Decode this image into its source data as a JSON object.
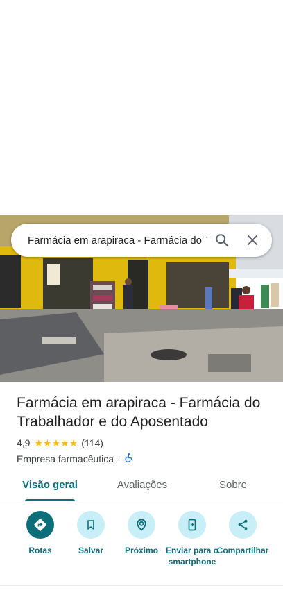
{
  "search": {
    "query": "Farmácia em arapiraca - Farmácia do Trabalhador e do Aposentado"
  },
  "place": {
    "name": "Farmácia em arapiraca - Farmácia do Trabalhador e do Aposentado",
    "rating": "4,9",
    "stars": 5,
    "review_count": "(114)",
    "category": "Empresa farmacêutica",
    "separator": "·"
  },
  "tabs": [
    {
      "label": "Visão geral",
      "selected": true
    },
    {
      "label": "Avaliações",
      "selected": false
    },
    {
      "label": "Sobre",
      "selected": false
    }
  ],
  "actions": [
    {
      "label": "Rotas",
      "icon": "directions-icon"
    },
    {
      "label": "Salvar",
      "icon": "bookmark-icon"
    },
    {
      "label": "Próximo",
      "icon": "nearby-icon"
    },
    {
      "label": "Enviar para o smartphone",
      "icon": "send-to-phone-icon"
    },
    {
      "label": "Compartilhar",
      "icon": "share-icon"
    }
  ],
  "colors": {
    "accent": "#0b6e79",
    "action_bg": "#c8eef7",
    "star": "#fbbc04",
    "accessibility": "#1a73e8"
  }
}
